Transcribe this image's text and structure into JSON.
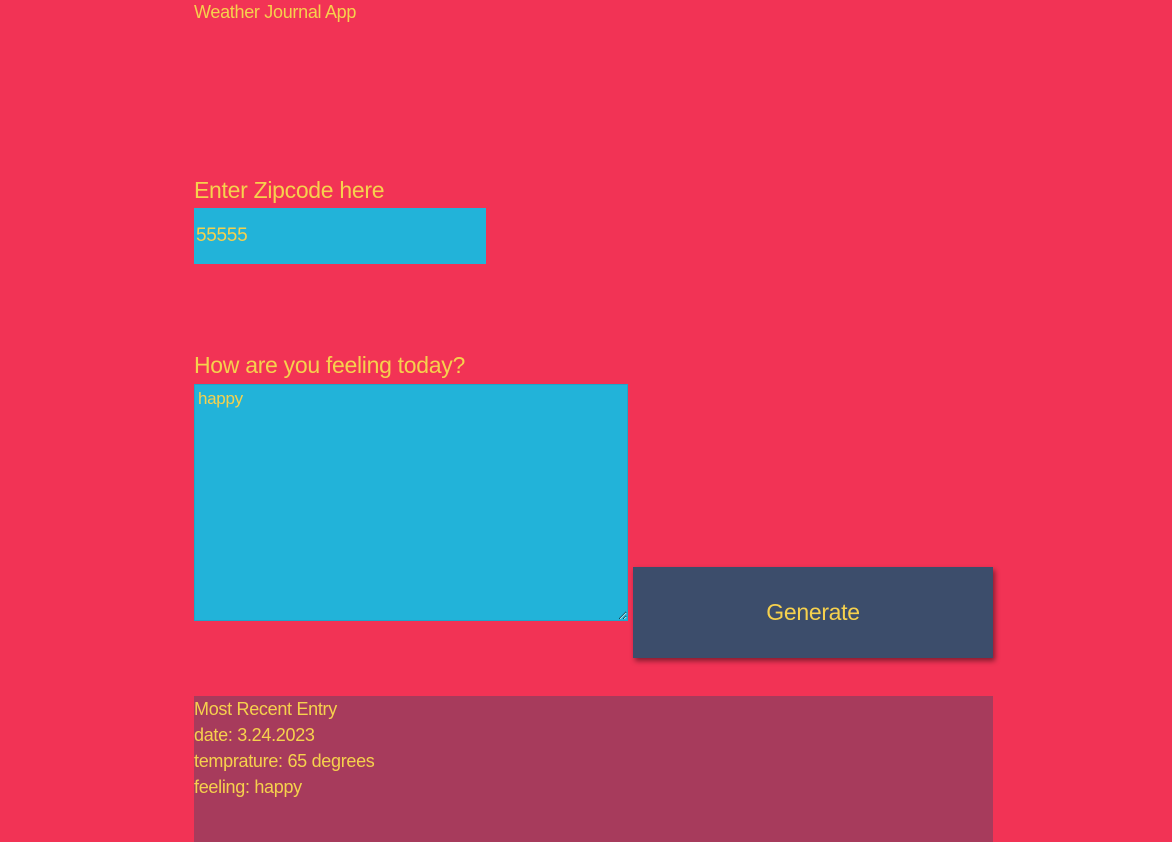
{
  "app": {
    "title": "Weather Journal App"
  },
  "zip": {
    "label": "Enter Zipcode here",
    "value": "55555"
  },
  "feelings": {
    "label": "How are you feeling today?",
    "value": "happy"
  },
  "generate": {
    "label": "Generate"
  },
  "entry": {
    "title": "Most Recent Entry",
    "date": "date: 3.24.2023",
    "temp": "temprature: 65 degrees",
    "feeling": "feeling: happy"
  },
  "colors": {
    "background": "#f23355",
    "text": "#f6d14d",
    "input": "#22b3d9",
    "button": "#3c4d6b",
    "entry_panel": "#a73b5c"
  }
}
